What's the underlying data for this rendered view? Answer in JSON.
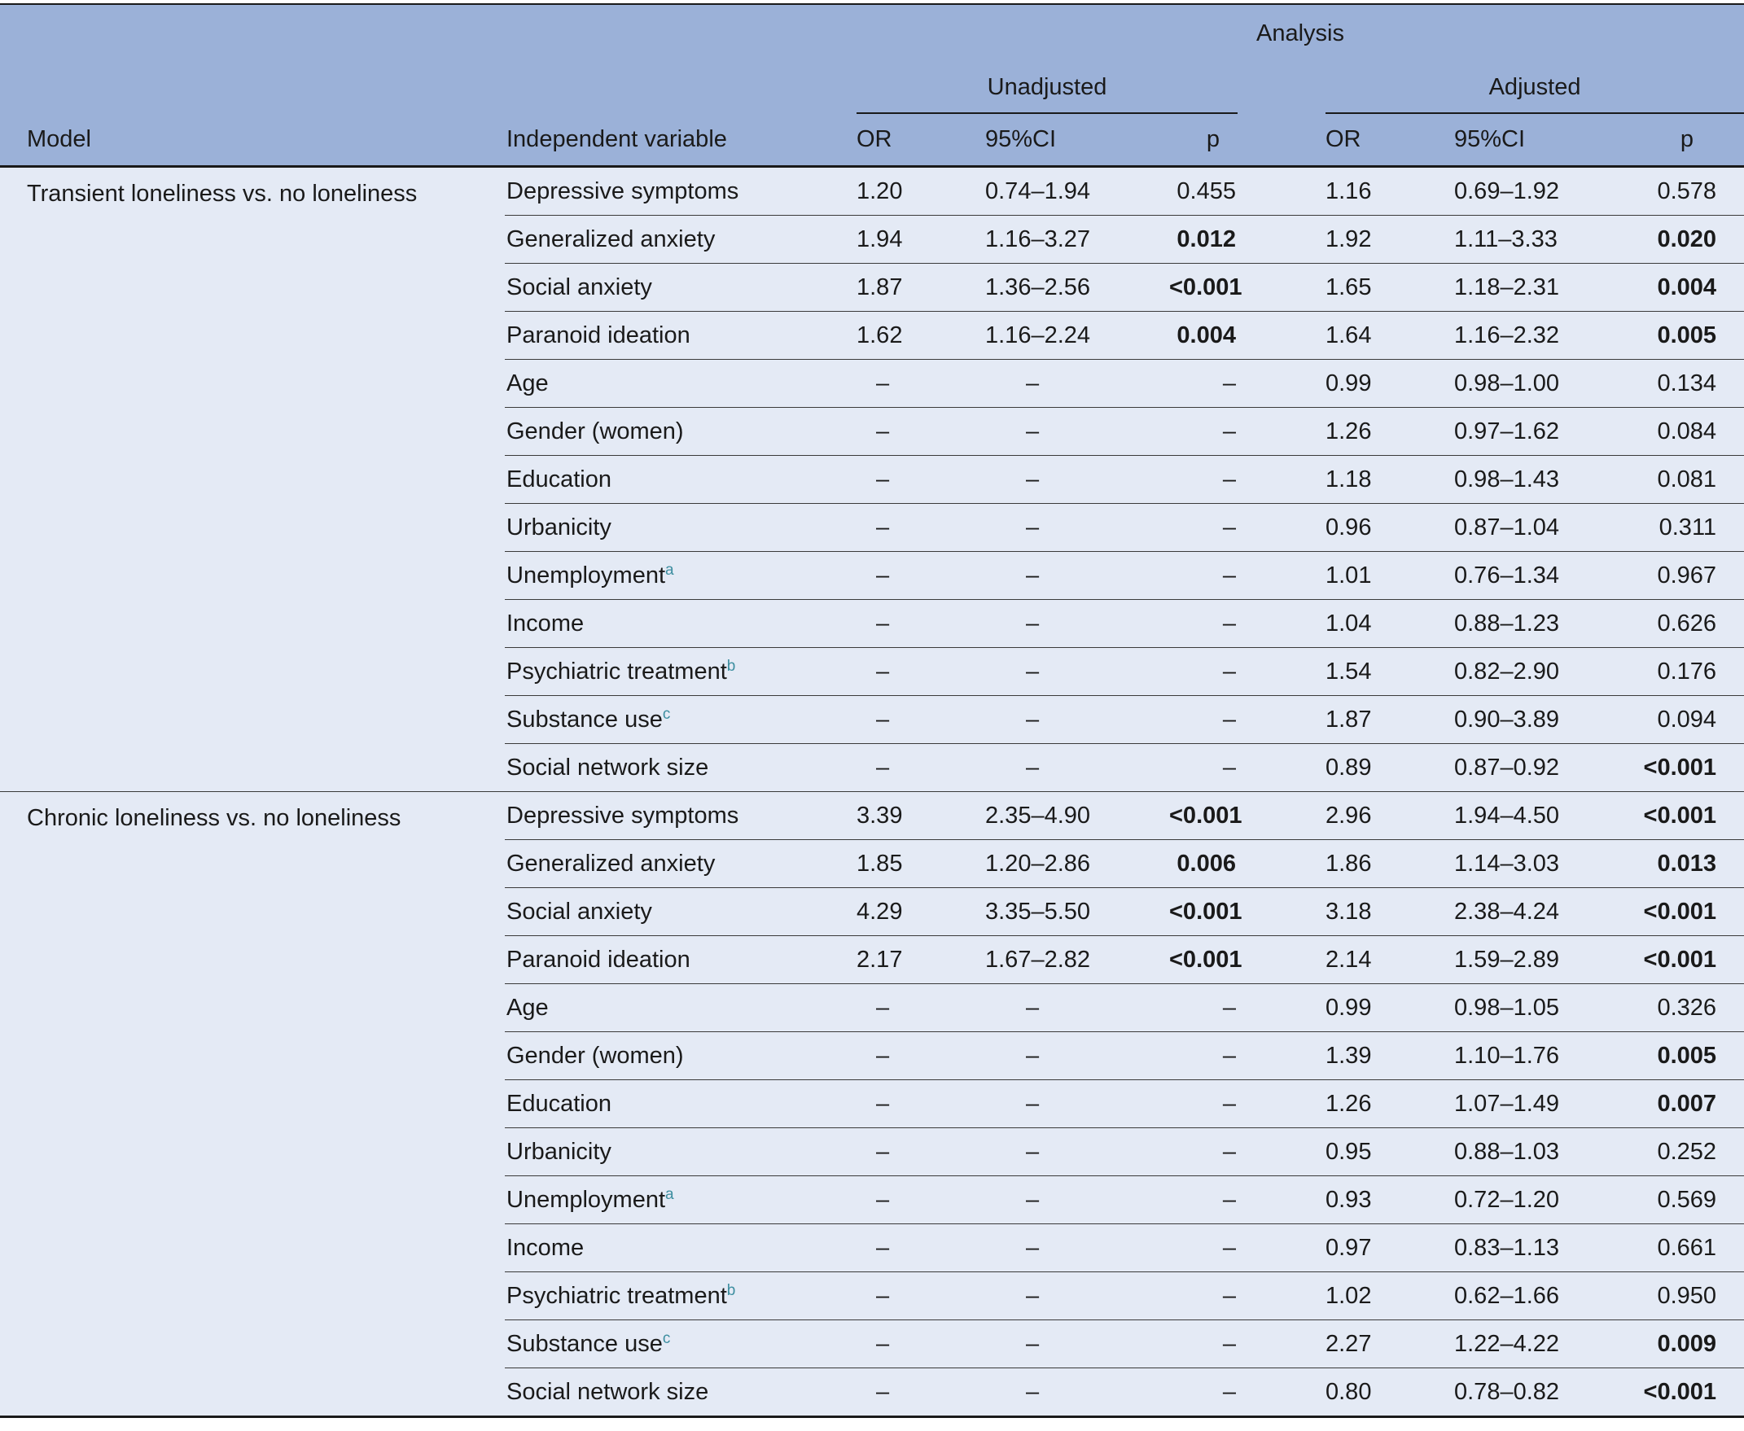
{
  "header": {
    "analysis": "Analysis",
    "unadjusted": "Unadjusted",
    "adjusted": "Adjusted",
    "model": "Model",
    "independent_variable": "Independent variable",
    "or": "OR",
    "ci": "95%CI",
    "p": "p"
  },
  "blocks": [
    {
      "model": "Transient loneliness vs. no loneliness",
      "rows": [
        {
          "var": "Depressive symptoms",
          "sup": "",
          "u_or": "1.20",
          "u_ci": "0.74–1.94",
          "u_p": "0.455",
          "u_bold": false,
          "a_or": "1.16",
          "a_ci": "0.69–1.92",
          "a_p": "0.578",
          "a_bold": false
        },
        {
          "var": "Generalized anxiety",
          "sup": "",
          "u_or": "1.94",
          "u_ci": "1.16–3.27",
          "u_p": "0.012",
          "u_bold": true,
          "a_or": "1.92",
          "a_ci": "1.11–3.33",
          "a_p": "0.020",
          "a_bold": true
        },
        {
          "var": "Social anxiety",
          "sup": "",
          "u_or": "1.87",
          "u_ci": "1.36–2.56",
          "u_p": "<0.001",
          "u_bold": true,
          "a_or": "1.65",
          "a_ci": "1.18–2.31",
          "a_p": "0.004",
          "a_bold": true
        },
        {
          "var": "Paranoid ideation",
          "sup": "",
          "u_or": "1.62",
          "u_ci": "1.16–2.24",
          "u_p": "0.004",
          "u_bold": true,
          "a_or": "1.64",
          "a_ci": "1.16–2.32",
          "a_p": "0.005",
          "a_bold": true
        },
        {
          "var": "Age",
          "sup": "",
          "u_or": "–",
          "u_ci": "–",
          "u_p": "–",
          "u_bold": false,
          "a_or": "0.99",
          "a_ci": "0.98–1.00",
          "a_p": "0.134",
          "a_bold": false
        },
        {
          "var": "Gender (women)",
          "sup": "",
          "u_or": "–",
          "u_ci": "–",
          "u_p": "–",
          "u_bold": false,
          "a_or": "1.26",
          "a_ci": "0.97–1.62",
          "a_p": "0.084",
          "a_bold": false
        },
        {
          "var": "Education",
          "sup": "",
          "u_or": "–",
          "u_ci": "–",
          "u_p": "–",
          "u_bold": false,
          "a_or": "1.18",
          "a_ci": "0.98–1.43",
          "a_p": "0.081",
          "a_bold": false
        },
        {
          "var": "Urbanicity",
          "sup": "",
          "u_or": "–",
          "u_ci": "–",
          "u_p": "–",
          "u_bold": false,
          "a_or": "0.96",
          "a_ci": "0.87–1.04",
          "a_p": "0.311",
          "a_bold": false
        },
        {
          "var": "Unemployment",
          "sup": "a",
          "u_or": "–",
          "u_ci": "–",
          "u_p": "–",
          "u_bold": false,
          "a_or": "1.01",
          "a_ci": "0.76–1.34",
          "a_p": "0.967",
          "a_bold": false
        },
        {
          "var": "Income",
          "sup": "",
          "u_or": "–",
          "u_ci": "–",
          "u_p": "–",
          "u_bold": false,
          "a_or": "1.04",
          "a_ci": "0.88–1.23",
          "a_p": "0.626",
          "a_bold": false
        },
        {
          "var": "Psychiatric treatment",
          "sup": "b",
          "u_or": "–",
          "u_ci": "–",
          "u_p": "–",
          "u_bold": false,
          "a_or": "1.54",
          "a_ci": "0.82–2.90",
          "a_p": "0.176",
          "a_bold": false
        },
        {
          "var": "Substance use",
          "sup": "c",
          "u_or": "–",
          "u_ci": "–",
          "u_p": "–",
          "u_bold": false,
          "a_or": "1.87",
          "a_ci": "0.90–3.89",
          "a_p": "0.094",
          "a_bold": false
        },
        {
          "var": "Social network size",
          "sup": "",
          "u_or": "–",
          "u_ci": "–",
          "u_p": "–",
          "u_bold": false,
          "a_or": "0.89",
          "a_ci": "0.87–0.92",
          "a_p": "<0.001",
          "a_bold": true
        }
      ]
    },
    {
      "model": "Chronic loneliness vs. no loneliness",
      "rows": [
        {
          "var": "Depressive symptoms",
          "sup": "",
          "u_or": "3.39",
          "u_ci": "2.35–4.90",
          "u_p": "<0.001",
          "u_bold": true,
          "a_or": "2.96",
          "a_ci": "1.94–4.50",
          "a_p": "<0.001",
          "a_bold": true
        },
        {
          "var": "Generalized anxiety",
          "sup": "",
          "u_or": "1.85",
          "u_ci": "1.20–2.86",
          "u_p": "0.006",
          "u_bold": true,
          "a_or": "1.86",
          "a_ci": "1.14–3.03",
          "a_p": "0.013",
          "a_bold": true
        },
        {
          "var": "Social anxiety",
          "sup": "",
          "u_or": "4.29",
          "u_ci": "3.35–5.50",
          "u_p": "<0.001",
          "u_bold": true,
          "a_or": "3.18",
          "a_ci": "2.38–4.24",
          "a_p": "<0.001",
          "a_bold": true
        },
        {
          "var": "Paranoid ideation",
          "sup": "",
          "u_or": "2.17",
          "u_ci": "1.67–2.82",
          "u_p": "<0.001",
          "u_bold": true,
          "a_or": "2.14",
          "a_ci": "1.59–2.89",
          "a_p": "<0.001",
          "a_bold": true
        },
        {
          "var": "Age",
          "sup": "",
          "u_or": "–",
          "u_ci": "–",
          "u_p": "–",
          "u_bold": false,
          "a_or": "0.99",
          "a_ci": "0.98–1.05",
          "a_p": "0.326",
          "a_bold": false
        },
        {
          "var": "Gender (women)",
          "sup": "",
          "u_or": "–",
          "u_ci": "–",
          "u_p": "–",
          "u_bold": false,
          "a_or": "1.39",
          "a_ci": "1.10–1.76",
          "a_p": "0.005",
          "a_bold": true
        },
        {
          "var": "Education",
          "sup": "",
          "u_or": "–",
          "u_ci": "–",
          "u_p": "–",
          "u_bold": false,
          "a_or": "1.26",
          "a_ci": "1.07–1.49",
          "a_p": "0.007",
          "a_bold": true
        },
        {
          "var": "Urbanicity",
          "sup": "",
          "u_or": "–",
          "u_ci": "–",
          "u_p": "–",
          "u_bold": false,
          "a_or": "0.95",
          "a_ci": "0.88–1.03",
          "a_p": "0.252",
          "a_bold": false
        },
        {
          "var": "Unemployment",
          "sup": "a",
          "u_or": "–",
          "u_ci": "–",
          "u_p": "–",
          "u_bold": false,
          "a_or": "0.93",
          "a_ci": "0.72–1.20",
          "a_p": "0.569",
          "a_bold": false
        },
        {
          "var": "Income",
          "sup": "",
          "u_or": "–",
          "u_ci": "–",
          "u_p": "–",
          "u_bold": false,
          "a_or": "0.97",
          "a_ci": "0.83–1.13",
          "a_p": "0.661",
          "a_bold": false
        },
        {
          "var": "Psychiatric treatment",
          "sup": "b",
          "u_or": "–",
          "u_ci": "–",
          "u_p": "–",
          "u_bold": false,
          "a_or": "1.02",
          "a_ci": "0.62–1.66",
          "a_p": "0.950",
          "a_bold": false
        },
        {
          "var": "Substance use",
          "sup": "c",
          "u_or": "–",
          "u_ci": "–",
          "u_p": "–",
          "u_bold": false,
          "a_or": "2.27",
          "a_ci": "1.22–4.22",
          "a_p": "0.009",
          "a_bold": true
        },
        {
          "var": "Social network size",
          "sup": "",
          "u_or": "–",
          "u_ci": "–",
          "u_p": "–",
          "u_bold": false,
          "a_or": "0.80",
          "a_ci": "0.78–0.82",
          "a_p": "<0.001",
          "a_bold": true
        }
      ]
    }
  ]
}
